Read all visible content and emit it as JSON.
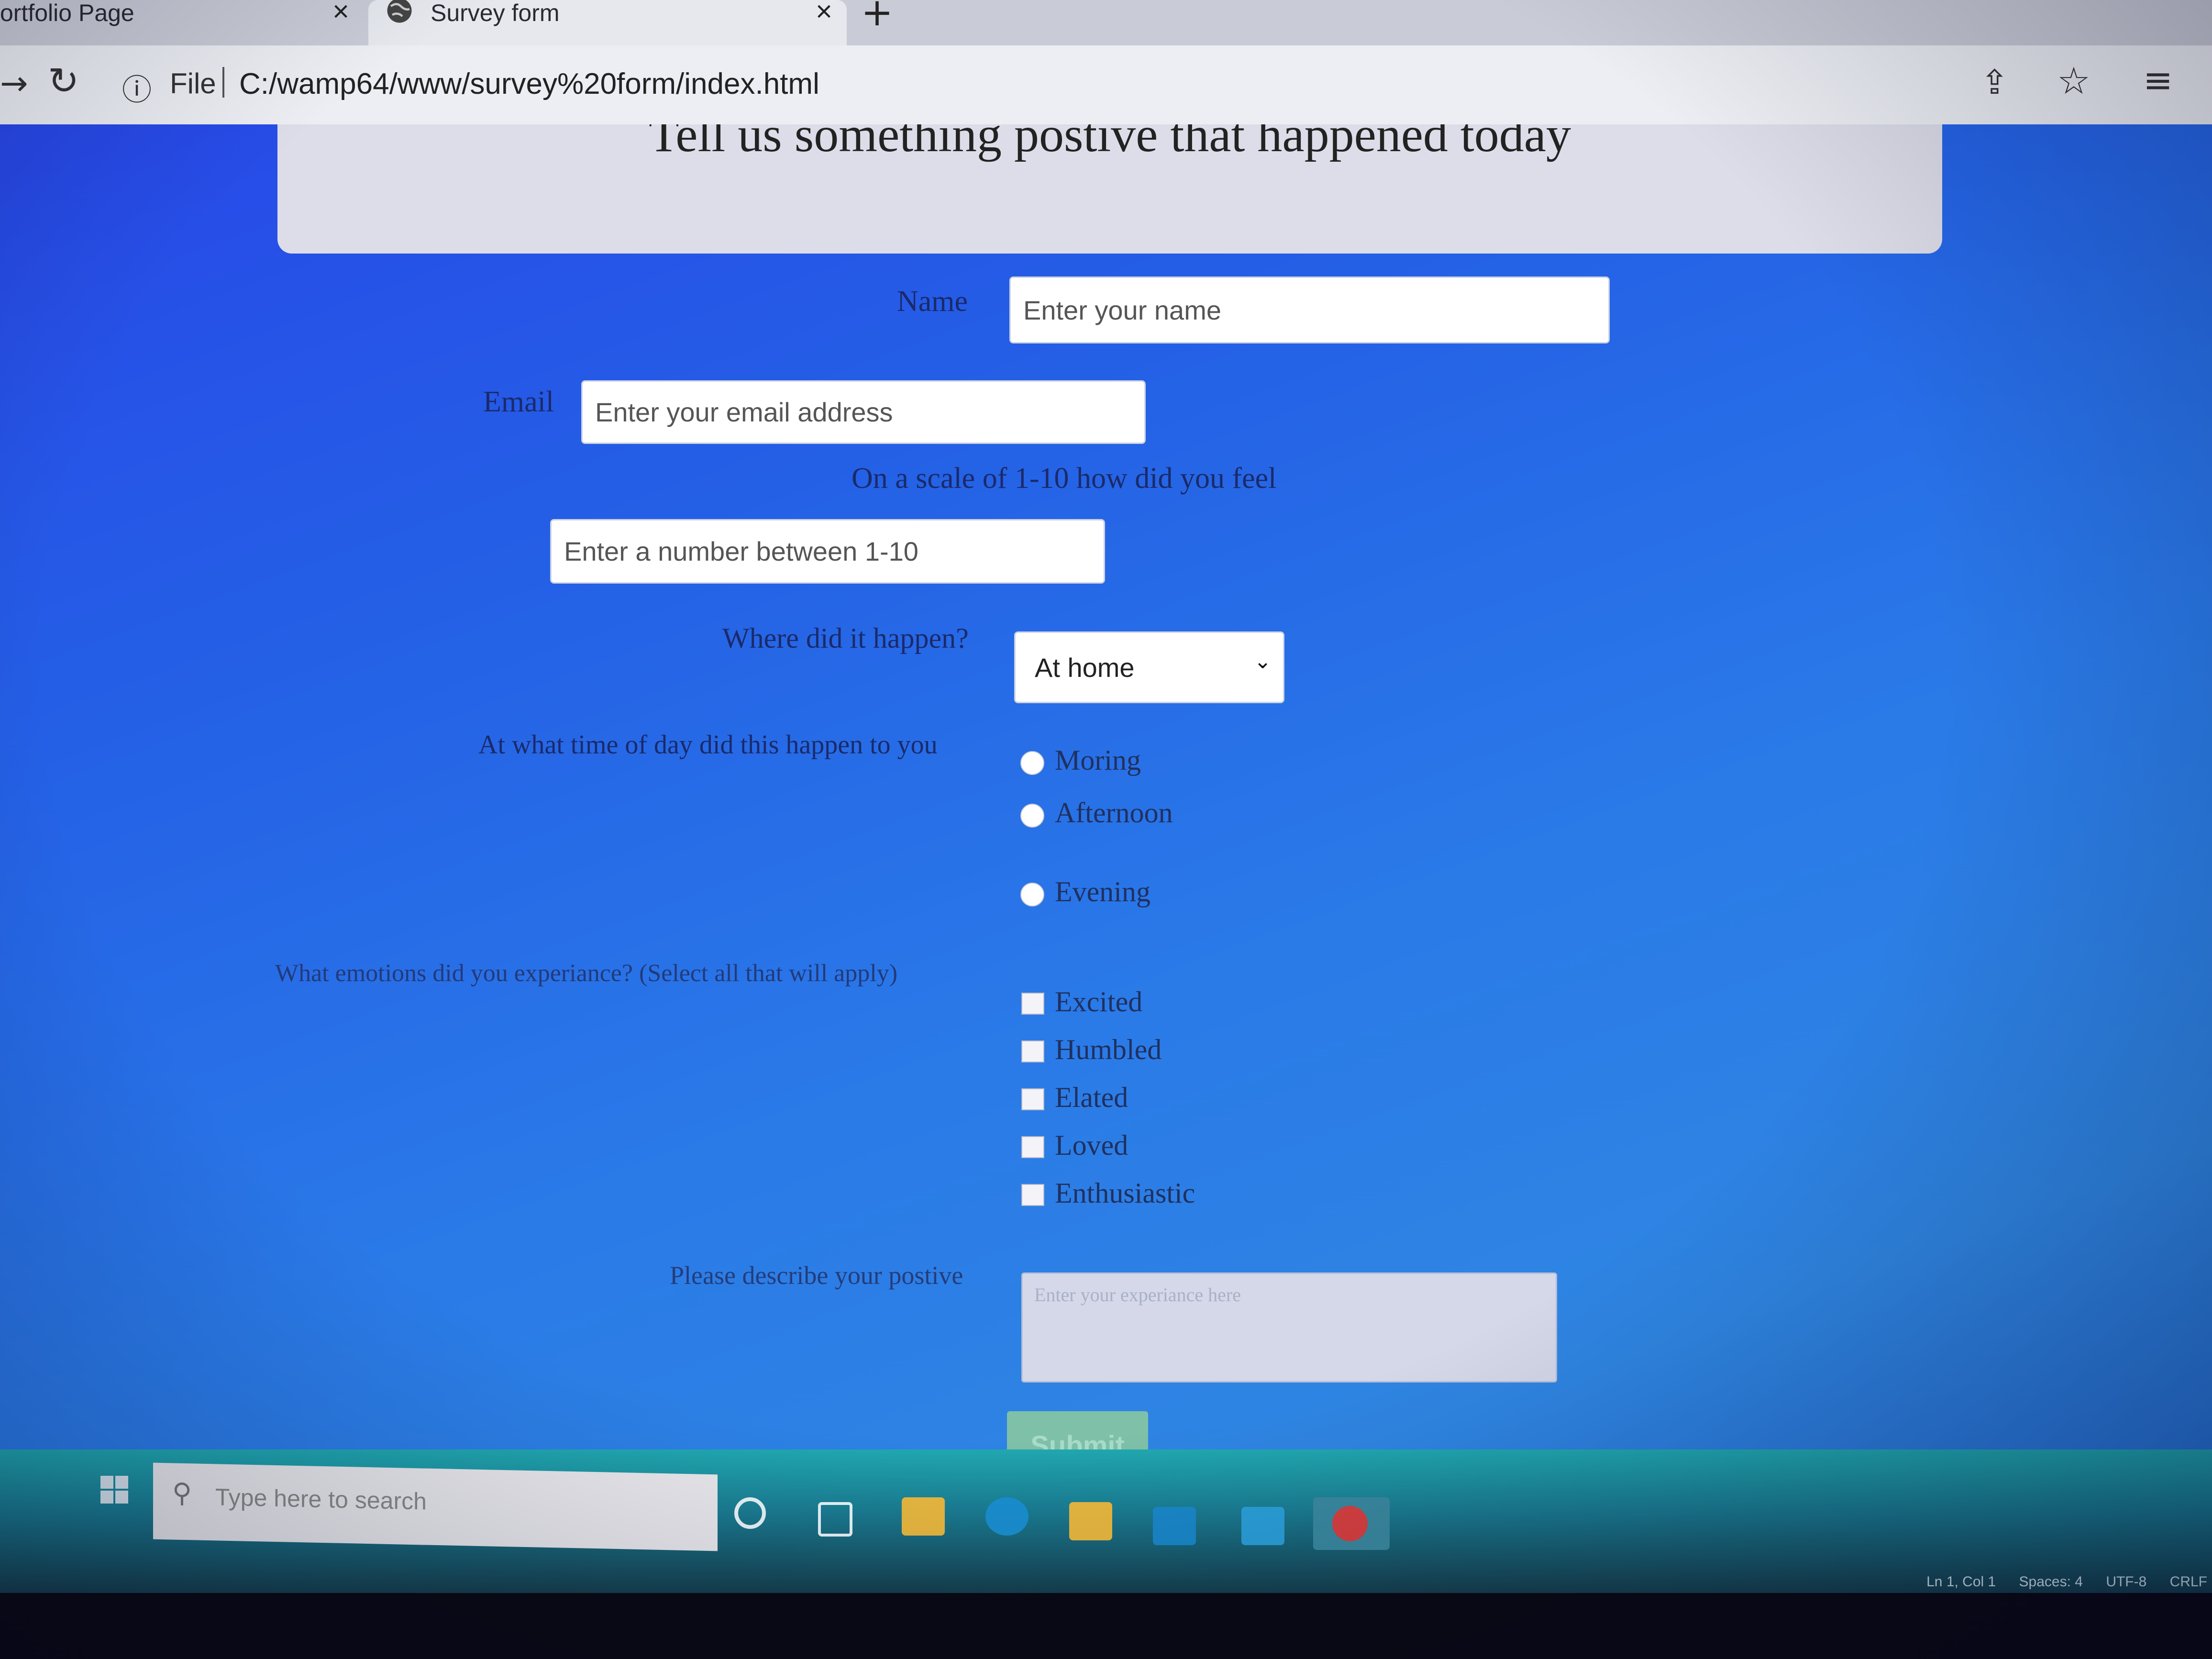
{
  "browser": {
    "tabs": [
      {
        "label": "ortfolio Page",
        "close": "×"
      },
      {
        "label": "Survey form",
        "close": "×"
      }
    ],
    "new_tab": "+",
    "file_label": "File",
    "url": "C:/wamp64/www/survey%20form/index.html"
  },
  "survey": {
    "title": "Tell us something postive that happened today",
    "name_label": "Name",
    "name_placeholder": "Enter your name",
    "email_label": "Email",
    "email_placeholder": "Enter your email address",
    "scale_label": "On a scale of 1-10 how did you feel",
    "scale_placeholder": "Enter a number between 1-10",
    "where_label": "Where did it happen?",
    "where_selected": "At home",
    "time_label": "At what time of day did this happen to you",
    "time_options": [
      "Moring",
      "Afternoon",
      "Evening"
    ],
    "emotions_label": "What emotions did you experiance? (Select all that will apply)",
    "emotion_options": [
      "Excited",
      "Humbled",
      "Elated",
      "Loved",
      "Enthusiastic"
    ],
    "describe_label": "Please describe your postive",
    "describe_placeholder": "Enter your experiance here",
    "submit_label": "Submit"
  },
  "taskbar": {
    "search_placeholder": "Type here to search",
    "status": [
      "Ln 1, Col 1",
      "Spaces: 4",
      "UTF-8",
      "CRLF"
    ]
  }
}
